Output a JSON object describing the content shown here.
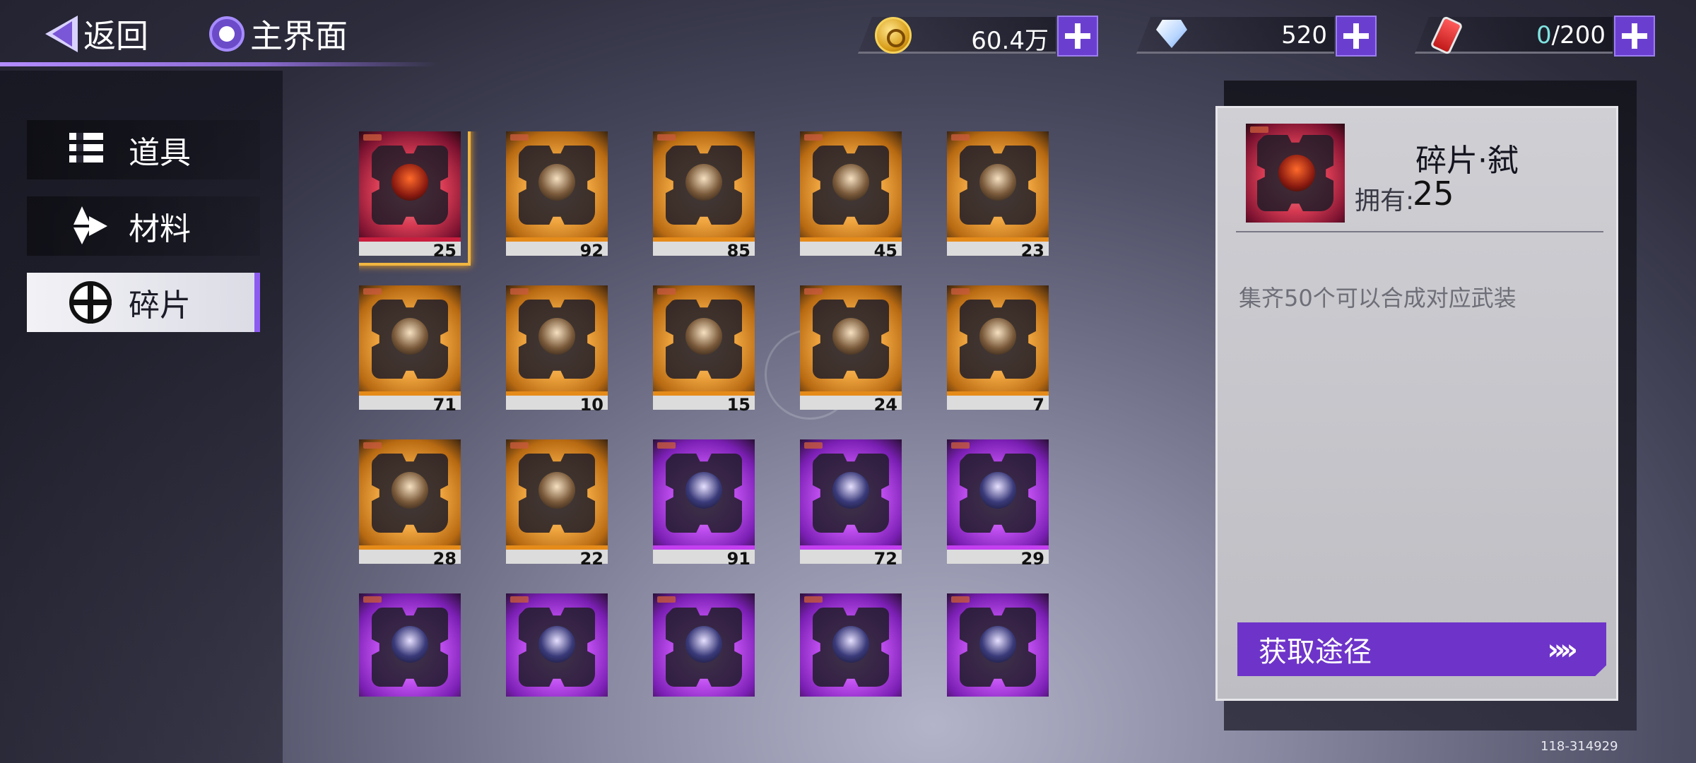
{
  "topbar": {
    "back_label": "返回",
    "home_label": "主界面"
  },
  "currencies": [
    {
      "name": "gold",
      "icon": "gold-coin-icon",
      "value": "60.4万"
    },
    {
      "name": "diamond",
      "icon": "diamond-icon",
      "value": "520"
    },
    {
      "name": "energy",
      "icon": "energy-bottle-icon",
      "value_current": "0",
      "value_max": "/200"
    }
  ],
  "sidebar": {
    "tabs": [
      {
        "label": "道具",
        "icon": "list-icon",
        "active": false
      },
      {
        "label": "材料",
        "icon": "material-icon",
        "active": false
      },
      {
        "label": "碎片",
        "icon": "fragment-icon",
        "active": true
      }
    ]
  },
  "grid": {
    "items": [
      {
        "count": "25",
        "rarity": "red",
        "selected": true
      },
      {
        "count": "92",
        "rarity": "orange"
      },
      {
        "count": "85",
        "rarity": "orange"
      },
      {
        "count": "45",
        "rarity": "orange"
      },
      {
        "count": "23",
        "rarity": "orange"
      },
      {
        "count": "71",
        "rarity": "orange"
      },
      {
        "count": "10",
        "rarity": "orange"
      },
      {
        "count": "15",
        "rarity": "orange"
      },
      {
        "count": "24",
        "rarity": "orange"
      },
      {
        "count": "7",
        "rarity": "orange"
      },
      {
        "count": "28",
        "rarity": "orange"
      },
      {
        "count": "22",
        "rarity": "orange"
      },
      {
        "count": "91",
        "rarity": "purple"
      },
      {
        "count": "72",
        "rarity": "purple"
      },
      {
        "count": "29",
        "rarity": "purple"
      },
      {
        "count": "",
        "rarity": "purple"
      },
      {
        "count": "",
        "rarity": "purple"
      },
      {
        "count": "",
        "rarity": "purple"
      },
      {
        "count": "",
        "rarity": "purple"
      },
      {
        "count": "",
        "rarity": "purple"
      }
    ]
  },
  "detail": {
    "title": "碎片·弑",
    "owned_label": "拥有:",
    "owned_value": "25",
    "description": "集齐50个可以合成对应武装",
    "acquire_label": "获取途径",
    "acquire_chevrons": "»»"
  },
  "watermark": "118-314929",
  "colors": {
    "accent": "#6e34c9",
    "orange_rarity": "#e58b1a",
    "purple_rarity": "#c33ff0",
    "red_rarity": "#c91e3e",
    "selected_frame": "#f0b640"
  }
}
